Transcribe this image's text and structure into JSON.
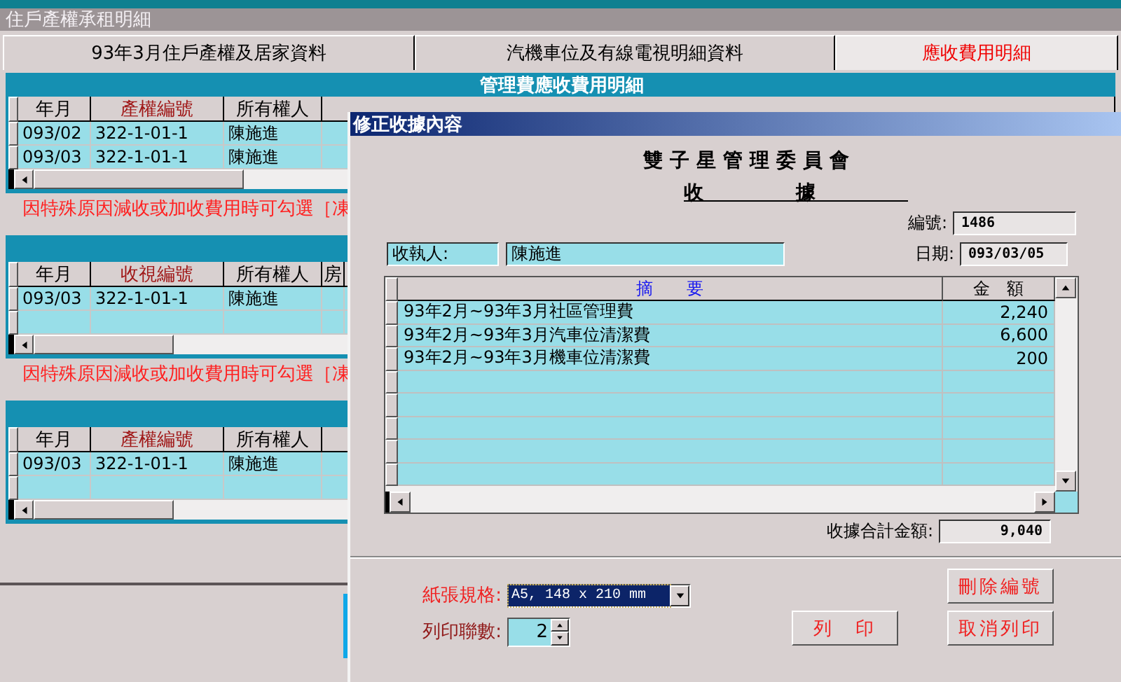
{
  "window": {
    "title": "住戶產權承租明細"
  },
  "tabs": [
    {
      "label": "93年3月住戶產權及居家資料",
      "selected": false
    },
    {
      "label": "汽機車位及有線電視明細資料",
      "selected": false
    },
    {
      "label": "應收費用明細",
      "selected": true
    }
  ],
  "panels": [
    {
      "header": "管理費應收費用明細",
      "columns": [
        {
          "label": "年月",
          "color": "#000000"
        },
        {
          "label": "產權編號",
          "color": "#a01818"
        },
        {
          "label": "所有權人",
          "color": "#000000"
        }
      ],
      "rows": [
        [
          "093/02",
          "322-1-01-1",
          "陳施進"
        ],
        [
          "093/03",
          "322-1-01-1",
          "陳施進"
        ]
      ],
      "note": "因特殊原因減收或加收費用時可勾選［凍"
    },
    {
      "columns": [
        {
          "label": "年月",
          "color": "#000000"
        },
        {
          "label": "收視編號",
          "color": "#a01818"
        },
        {
          "label": "所有權人",
          "color": "#000000"
        },
        {
          "label": "房",
          "color": "#000000"
        }
      ],
      "rows": [
        [
          "093/03",
          "322-1-01-1",
          "陳施進"
        ]
      ],
      "note": "因特殊原因減收或加收費用時可勾選［凍"
    },
    {
      "columns": [
        {
          "label": "年月",
          "color": "#000000"
        },
        {
          "label": "產權編號",
          "color": "#a01818"
        },
        {
          "label": "所有權人",
          "color": "#000000"
        }
      ],
      "rows": [
        [
          "093/03",
          "322-1-01-1",
          "陳施進"
        ]
      ]
    }
  ],
  "dialog": {
    "title": "修正收據內容",
    "organization": "雙子星管理委員會",
    "heading": "收據",
    "number_label": "編號:",
    "number": "1486",
    "payee_label": "收執人:",
    "payee": "陳施進",
    "date_label": "日期:",
    "date": "093/03/05",
    "columns": [
      "摘　　要",
      "金　額"
    ],
    "items": [
      {
        "summary": "93年2月~93年3月社區管理費",
        "amount": "2,240"
      },
      {
        "summary": "93年2月~93年3月汽車位清潔費",
        "amount": "6,600"
      },
      {
        "summary": "93年2月~93年3月機車位清潔費",
        "amount": "200"
      }
    ],
    "total_label": "收據合計金額:",
    "total": "9,040",
    "paper_label": "紙張規格:",
    "paper": "A5, 148 x 210 mm",
    "copies_label": "列印聯數:",
    "copies": "2",
    "buttons": [
      {
        "label": "刪除編號"
      },
      {
        "label": "列　印"
      },
      {
        "label": "取消列印"
      }
    ]
  }
}
